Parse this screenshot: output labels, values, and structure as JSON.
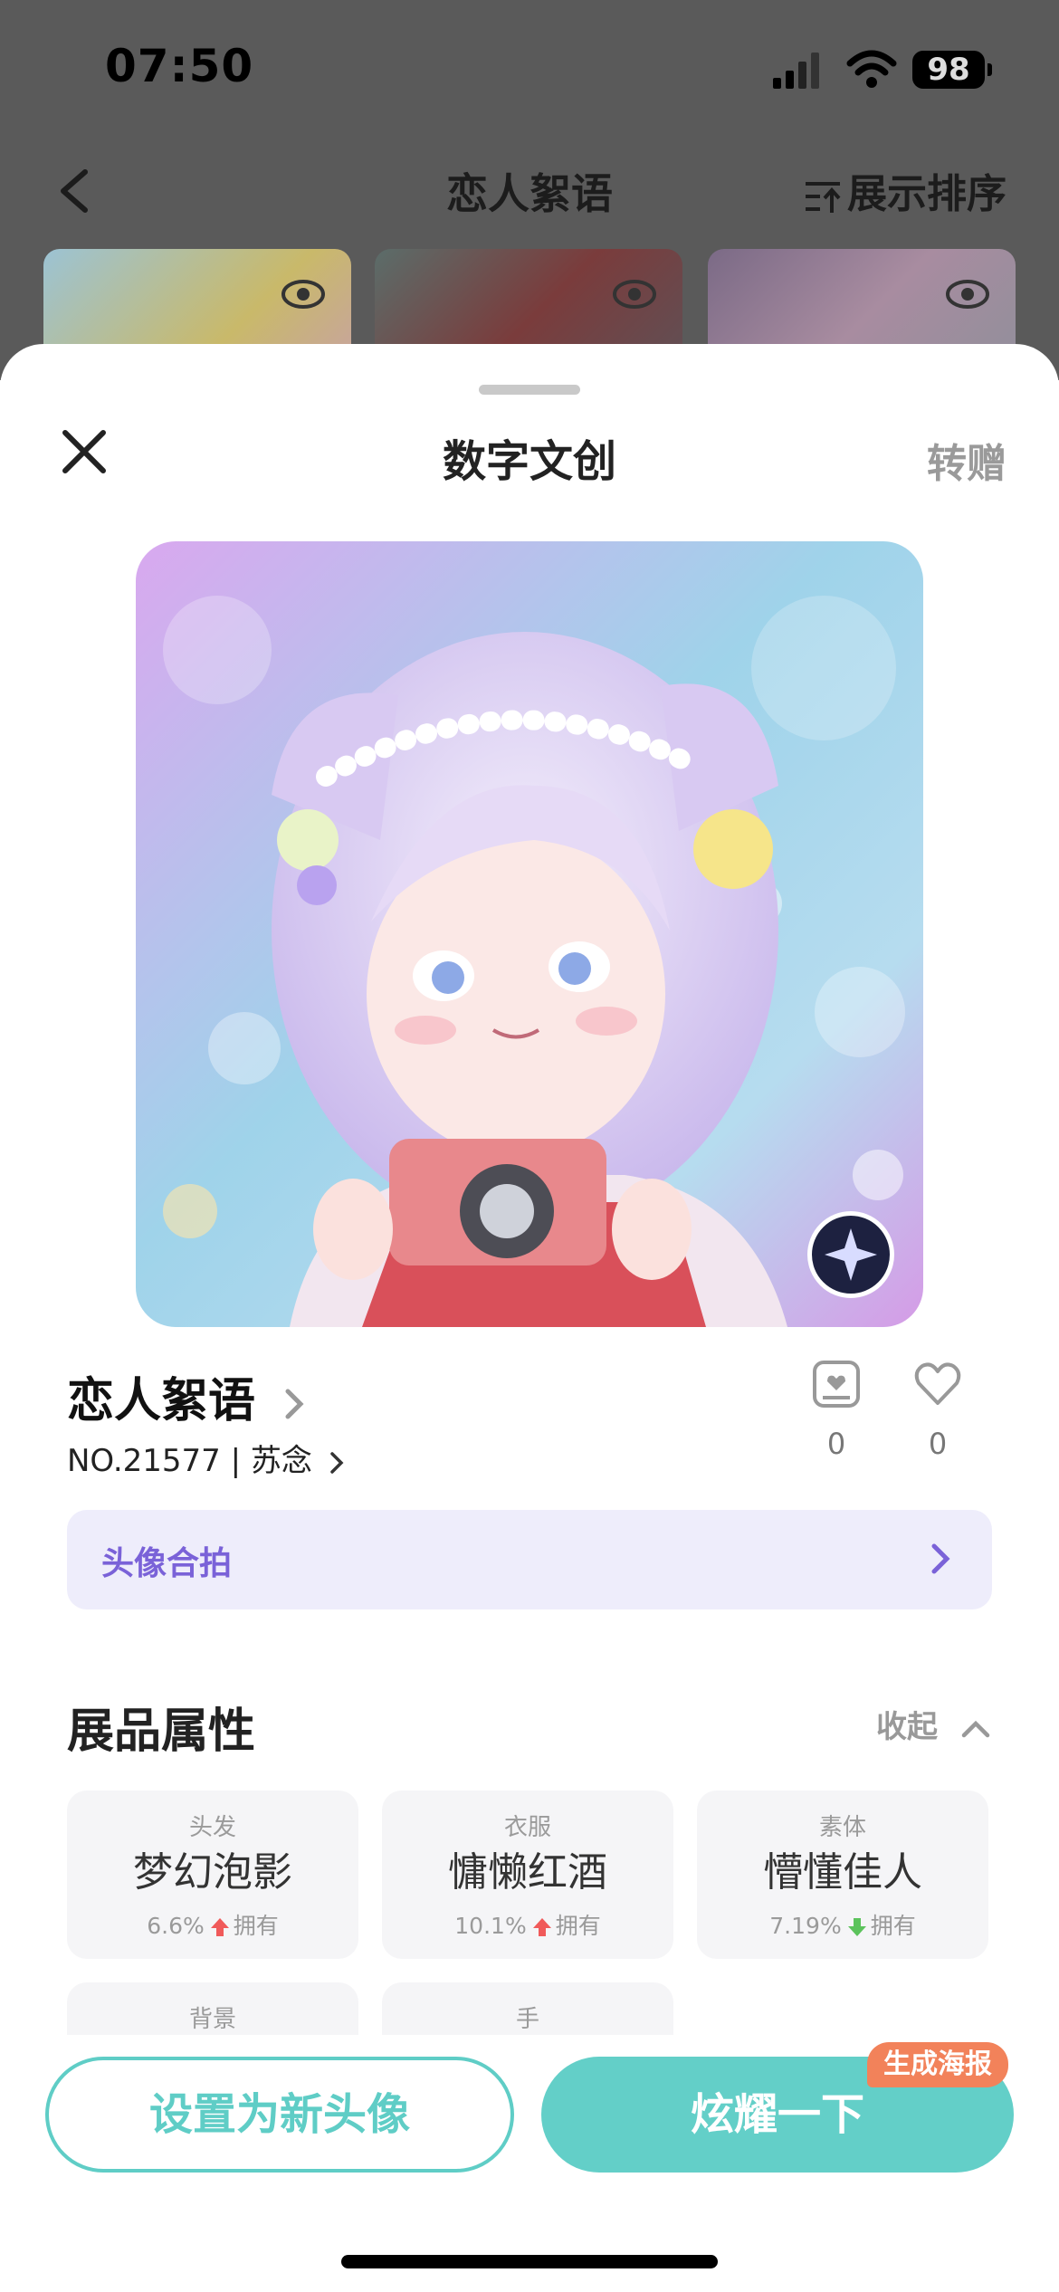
{
  "status_bar": {
    "time": "07:50",
    "battery": "98"
  },
  "navbar": {
    "title": "恋人絮语",
    "sort_label": "展示排序"
  },
  "sheet": {
    "title": "数字文创",
    "gift_label": "转赠",
    "item": {
      "name": "恋人絮语",
      "serial": "NO.21577 | 苏念",
      "stats": [
        {
          "icon": "collect-icon",
          "count": "0"
        },
        {
          "icon": "heart-icon",
          "count": "0"
        }
      ]
    },
    "coshot_label": "头像合拍",
    "attributes_title": "展品属性",
    "collapse_label": "收起",
    "attributes": [
      {
        "category": "头发",
        "value": "梦幻泡影",
        "percent": "6.6%",
        "owned": "拥有",
        "trend": "up",
        "trend_color": "#f05a5a"
      },
      {
        "category": "衣服",
        "value": "慵懒红酒",
        "percent": "10.1%",
        "owned": "拥有",
        "trend": "up",
        "trend_color": "#f05a5a"
      },
      {
        "category": "素体",
        "value": "懵懂佳人",
        "percent": "7.19%",
        "owned": "拥有",
        "trend": "down",
        "trend_color": "#5cc35c"
      },
      {
        "category": "背景"
      },
      {
        "category": "手"
      }
    ]
  },
  "actions": {
    "set_avatar": "设置为新头像",
    "show_off": "炫耀一下",
    "poster_badge": "生成海报"
  },
  "colors": {
    "accent": "#63cfc8",
    "purple": "#7a62d8",
    "badge": "#f2825a"
  }
}
